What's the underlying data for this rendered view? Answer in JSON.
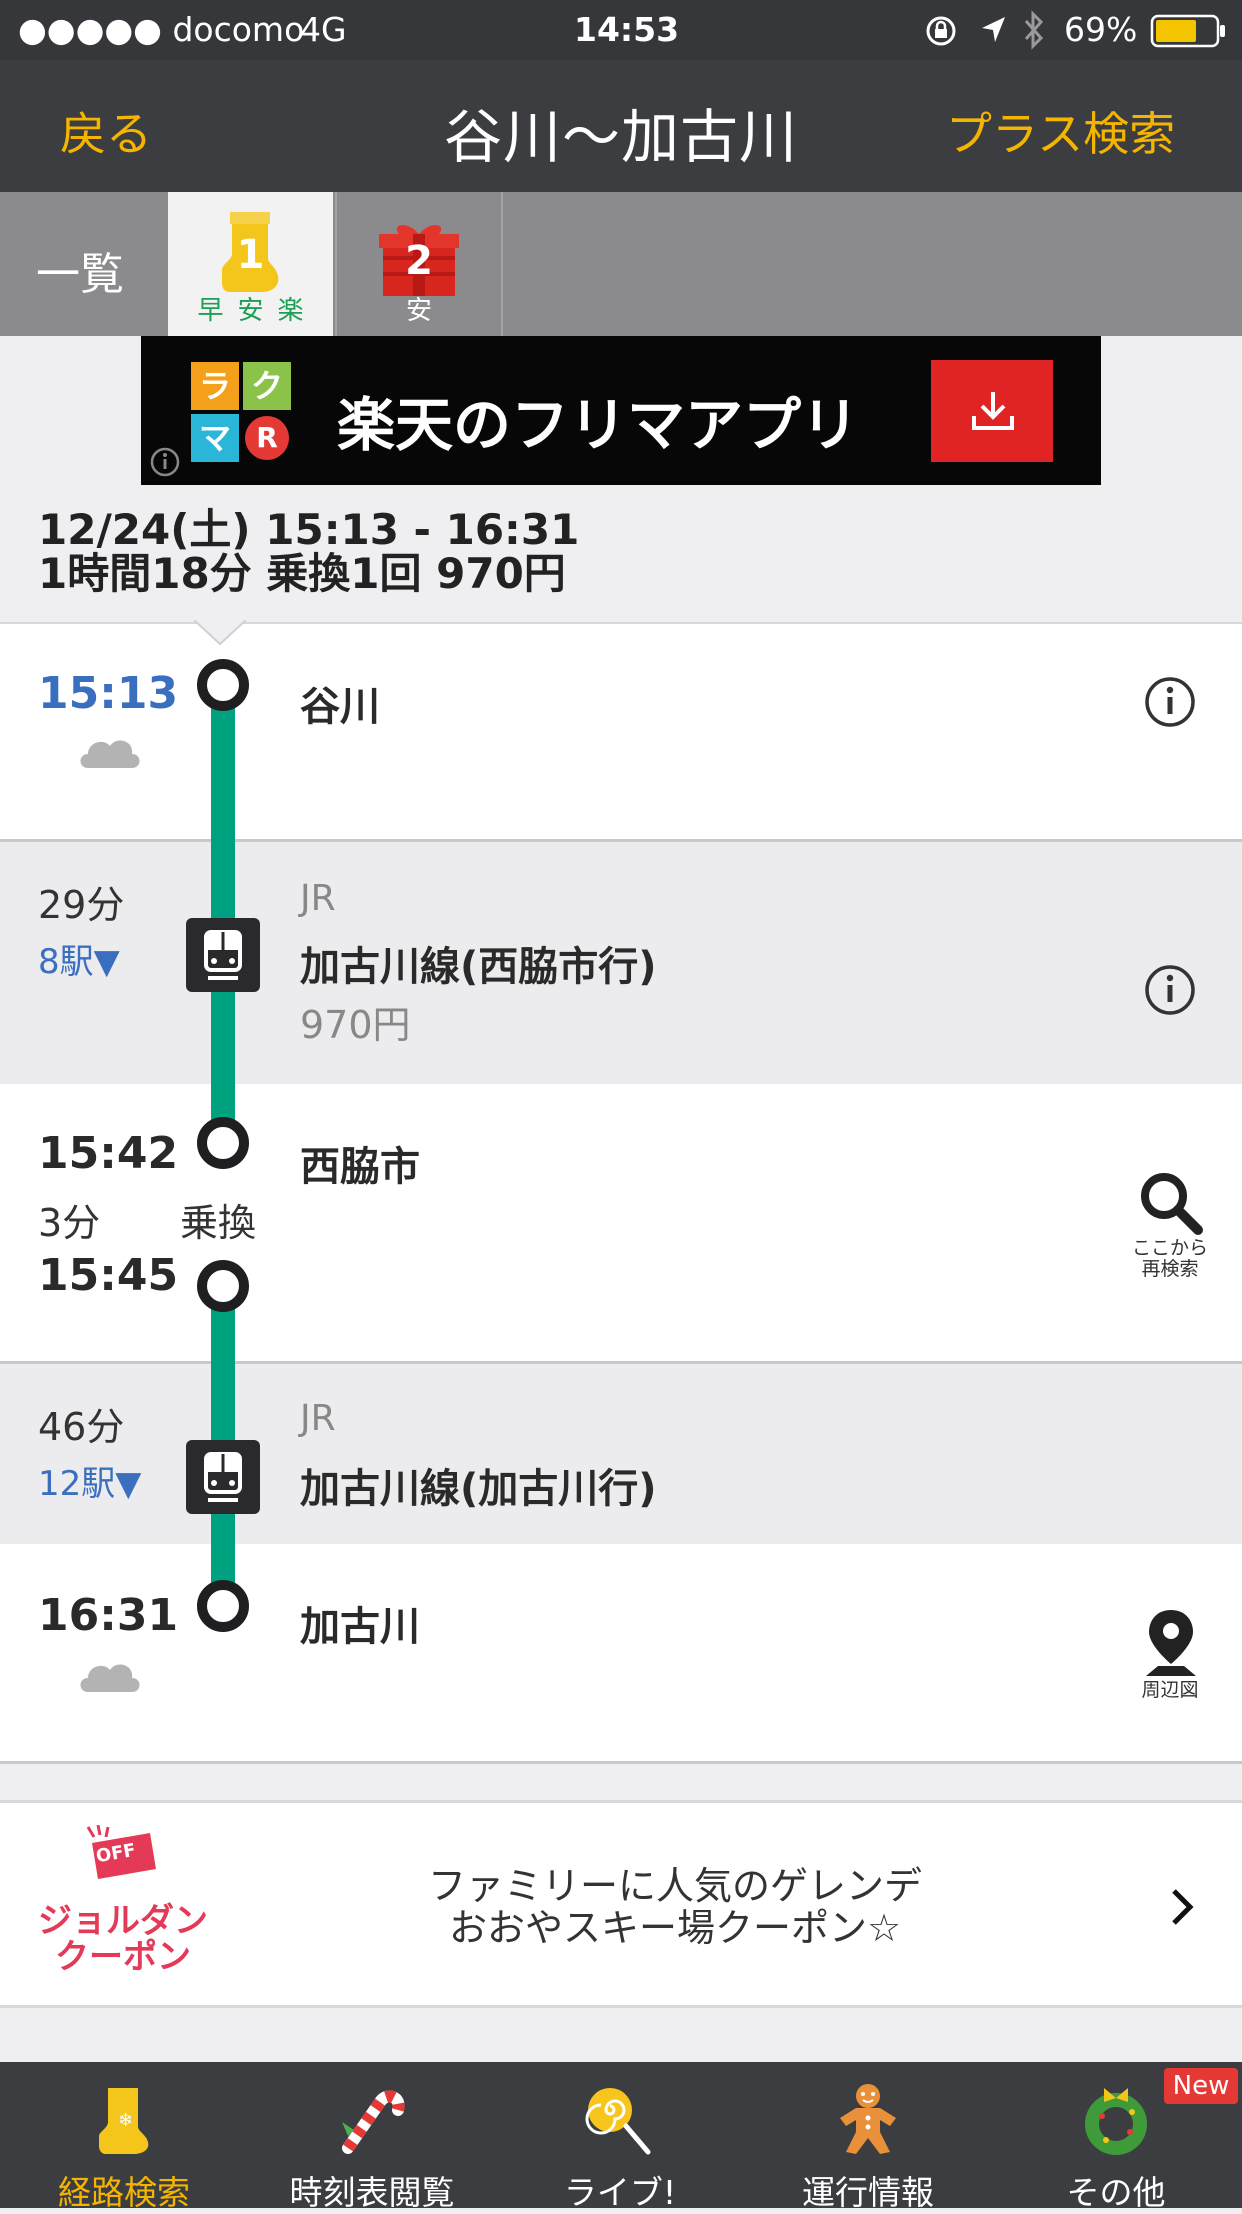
{
  "status_bar": {
    "signal": "●●●●● docomo",
    "network": "4G",
    "time": "14:53",
    "battery": "69%"
  },
  "nav": {
    "back_label": "戻る",
    "title": "谷川〜加古川",
    "plus_search_label": "プラス検索"
  },
  "tabs": {
    "list_label": "一覧",
    "route1_number": "1",
    "route1_tags": "早安楽",
    "route2_number": "2",
    "route2_tags": "安"
  },
  "ad_banner": {
    "logo_letters": [
      "ラ",
      "ク",
      "マ",
      "R"
    ],
    "text": "楽天のフリマアプリ"
  },
  "summary": {
    "date_time": "12/24(土) 15:13 - 16:31",
    "details": "1時間18分 乗換1回 970円"
  },
  "route": {
    "departure": {
      "time": "15:13",
      "station": "谷川",
      "weather": "cloud-icon"
    },
    "leg1": {
      "duration": "29分",
      "stops": "8駅▼",
      "company": "JR",
      "line": "加古川線(西脇市行)",
      "fare": "970円"
    },
    "transfer": {
      "arrive_time": "15:42",
      "station": "西脇市",
      "wait": "3分",
      "label": "乗換",
      "depart_time": "15:45",
      "research_caption_1": "ここから",
      "research_caption_2": "再検索"
    },
    "leg2": {
      "duration": "46分",
      "stops": "12駅▼",
      "company": "JR",
      "line": "加古川線(加古川行)"
    },
    "arrival": {
      "time": "16:31",
      "station": "加古川",
      "weather": "cloud-icon",
      "map_caption": "周辺図"
    }
  },
  "coupon": {
    "badge": "OFF",
    "brand_line1": "ジョルダン",
    "brand_line2": "クーポン",
    "text_line1": "ファミリーに人気のゲレンデ",
    "text_line2": "おおやスキー場クーポン☆"
  },
  "tab_bar": {
    "items": [
      {
        "label": "経路検索",
        "icon": "boot-icon"
      },
      {
        "label": "時刻表閲覧",
        "icon": "candy-cane-icon"
      },
      {
        "label": "ライブ!",
        "icon": "lollipop-icon"
      },
      {
        "label": "運行情報",
        "icon": "gingerbread-icon"
      },
      {
        "label": "その他",
        "icon": "wreath-icon"
      }
    ],
    "new_badge": "New"
  },
  "colors": {
    "accent": "#f4b400",
    "route_line": "#00a17e",
    "link_blue": "#3a6fc0",
    "header_bg": "#3b3d41"
  }
}
